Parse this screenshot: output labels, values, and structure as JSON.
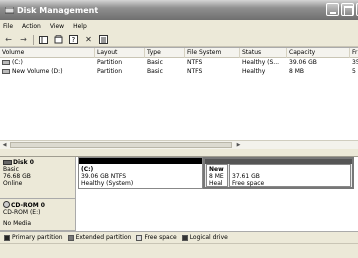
{
  "window": {
    "title": "Disk Management"
  },
  "menu": [
    "File",
    "Action",
    "View",
    "Help"
  ],
  "toolbar": {
    "icons": [
      "back-icon",
      "forward-icon",
      "console-tree-icon",
      "properties-icon",
      "help-icon",
      "delete-icon",
      "settings-icon"
    ]
  },
  "list": {
    "columns": [
      "Volume",
      "Layout",
      "Type",
      "File System",
      "Status",
      "Capacity",
      "Fr"
    ],
    "rows": [
      {
        "volume": "(C:)",
        "layout": "Partition",
        "type": "Basic",
        "fs": "NTFS",
        "status": "Healthy (S...",
        "capacity": "39.06 GB",
        "free": "35"
      },
      {
        "volume": "New Volume (D:)",
        "layout": "Partition",
        "type": "Basic",
        "fs": "NTFS",
        "status": "Healthy",
        "capacity": "8 MB",
        "free": "5 I"
      }
    ]
  },
  "disks": [
    {
      "name": "Disk 0",
      "kind": "Basic",
      "size": "76.68 GB",
      "state": "Online",
      "partitions": [
        {
          "title": "(C:)",
          "line1": "39.06 GB NTFS",
          "line2": "Healthy (System)",
          "bar_color": "#000000"
        },
        {
          "title": "New",
          "line1": "8 ME",
          "line2": "Heal",
          "bar_color": "#555555"
        },
        {
          "title": "",
          "line1": "37.61 GB",
          "line2": "Free space",
          "bar_color": "#555555"
        }
      ]
    },
    {
      "name": "CD-ROM 0",
      "kind": "CD-ROM (E:)",
      "size": "",
      "state": "No Media",
      "partitions": []
    }
  ],
  "legend": [
    {
      "label": "Primary partition",
      "color": "#222222"
    },
    {
      "label": "Extended partition",
      "color": "#777777"
    },
    {
      "label": "Free space",
      "color": "#dddddd"
    },
    {
      "label": "Logical drive",
      "color": "#333333"
    }
  ]
}
